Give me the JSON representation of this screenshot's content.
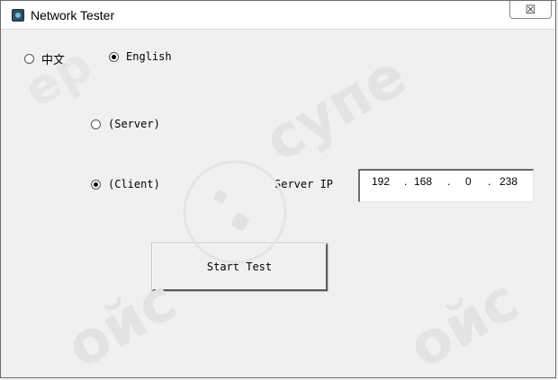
{
  "window": {
    "title": "Network Tester",
    "close_glyph": "☒",
    "icon": "network-app-icon"
  },
  "language": {
    "options": [
      {
        "label": "中文",
        "selected": false
      },
      {
        "label": "English",
        "selected": true
      }
    ]
  },
  "mode": {
    "options": [
      {
        "label": "(Server)",
        "selected": false
      },
      {
        "label": "(Client)",
        "selected": true
      }
    ]
  },
  "server_ip": {
    "label": "Server IP",
    "octets": [
      "192",
      "168",
      "0",
      "238"
    ],
    "separator": "."
  },
  "start_button": {
    "label": "Start Test"
  },
  "watermark": {
    "text": "cynepoйc"
  }
}
